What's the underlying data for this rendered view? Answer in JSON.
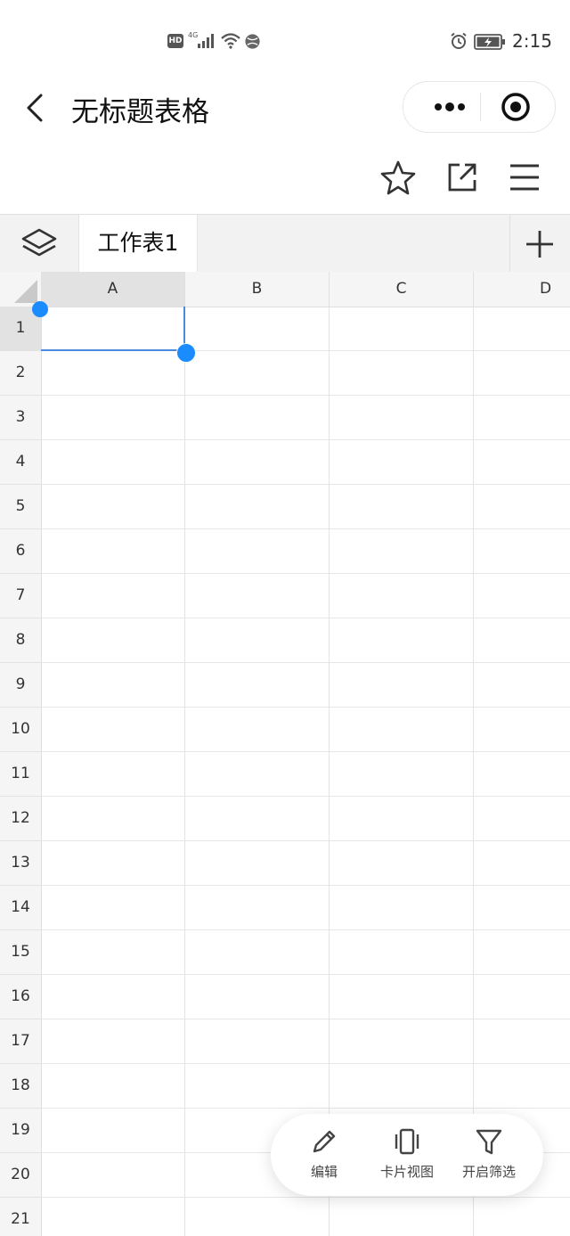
{
  "status_bar": {
    "hd": "HD",
    "network": "4G",
    "time": "2:15"
  },
  "nav": {
    "title": "无标题表格"
  },
  "sheet_tabs": {
    "active_tab": "工作表1"
  },
  "grid": {
    "columns": [
      "A",
      "B",
      "C",
      "D"
    ],
    "rows": [
      "1",
      "2",
      "3",
      "4",
      "5",
      "6",
      "7",
      "8",
      "9",
      "10",
      "11",
      "12",
      "13",
      "14",
      "15",
      "16",
      "17",
      "18",
      "19",
      "20",
      "21"
    ],
    "selected_cell": "A1"
  },
  "bottom_bar": {
    "edit_label": "编辑",
    "card_view_label": "卡片视图",
    "filter_label": "开启筛选"
  },
  "colors": {
    "accent": "#1a8cff",
    "selection_border": "#4a89dc"
  }
}
